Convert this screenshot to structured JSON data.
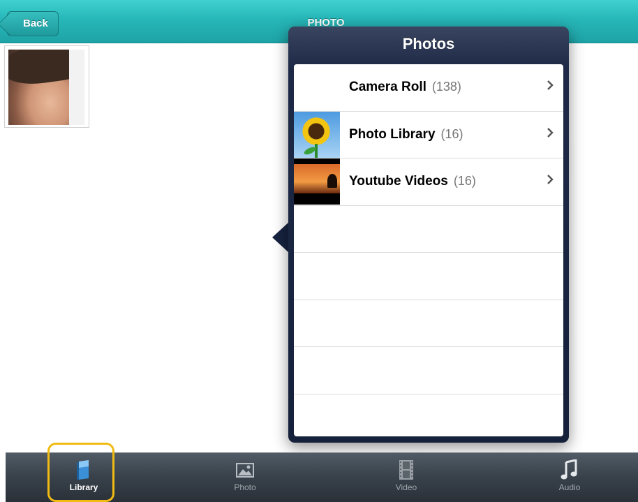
{
  "navbar": {
    "back_label": "Back",
    "title": "PHOTO"
  },
  "popover": {
    "title": "Photos",
    "items": [
      {
        "label": "Camera Roll",
        "count": "(138)",
        "thumbnail": "none"
      },
      {
        "label": "Photo Library",
        "count": "(16)",
        "thumbnail": "sunflower-image"
      },
      {
        "label": "Youtube Videos",
        "count": "(16)",
        "thumbnail": "sunset-video-image"
      }
    ]
  },
  "tabbar": {
    "tabs": [
      {
        "label": "Library",
        "icon": "library-book-icon",
        "active": true
      },
      {
        "label": "Photo",
        "icon": "photo-icon",
        "active": false
      },
      {
        "label": "Video",
        "icon": "film-strip-icon",
        "active": false
      },
      {
        "label": "Audio",
        "icon": "music-note-icon",
        "active": false
      }
    ]
  },
  "colors": {
    "navbar": "#27b7b8",
    "popover": "#1d2946",
    "highlight": "#f1bb13"
  }
}
